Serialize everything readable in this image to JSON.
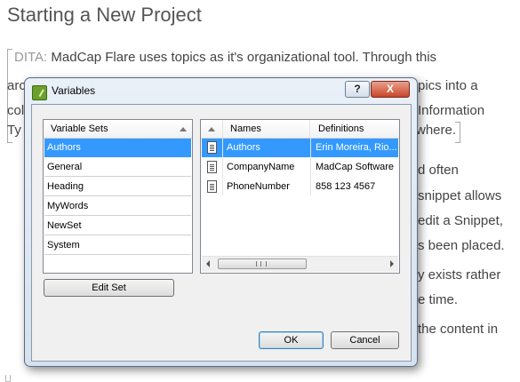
{
  "document": {
    "title": "Starting a New Project",
    "dita_tag": "DITA:",
    "lines": [
      " MadCap Flare uses topics as it's organizational tool. Through this",
      "arc",
      "pics into a",
      "col",
      "Information",
      "Ty",
      "where.",
      "d often",
      "snippet allows",
      "edit a Snippet,",
      "s been placed.",
      "y exists rather",
      "e time.",
      "the content in"
    ]
  },
  "dialog": {
    "title": "Variables",
    "help_label": "?",
    "close_label": "X",
    "variable_sets": {
      "header": "Variable Sets",
      "items": [
        "Authors",
        "General",
        "Heading",
        "MyWords",
        "NewSet",
        "System"
      ],
      "selected": "Authors"
    },
    "variables": {
      "headers": {
        "names": "Names",
        "definitions": "Definitions"
      },
      "rows": [
        {
          "name": "Authors",
          "definition": "Erin Moreira, Rio...",
          "selected": true
        },
        {
          "name": "CompanyName",
          "definition": "MadCap Software",
          "selected": false
        },
        {
          "name": "PhoneNumber",
          "definition": "858 123 4567",
          "selected": false
        }
      ],
      "scroll_grip": "III"
    },
    "buttons": {
      "edit_set": "Edit Set",
      "ok": "OK",
      "cancel": "Cancel"
    }
  },
  "colors": {
    "selection": "#3399ff",
    "close_button": "#c9472a",
    "dialog_frame": "#d5e1ee"
  },
  "icons": {
    "app": "flare-app-icon",
    "variable_row": "variable-document-icon",
    "sort": "sort-ascending-icon"
  }
}
